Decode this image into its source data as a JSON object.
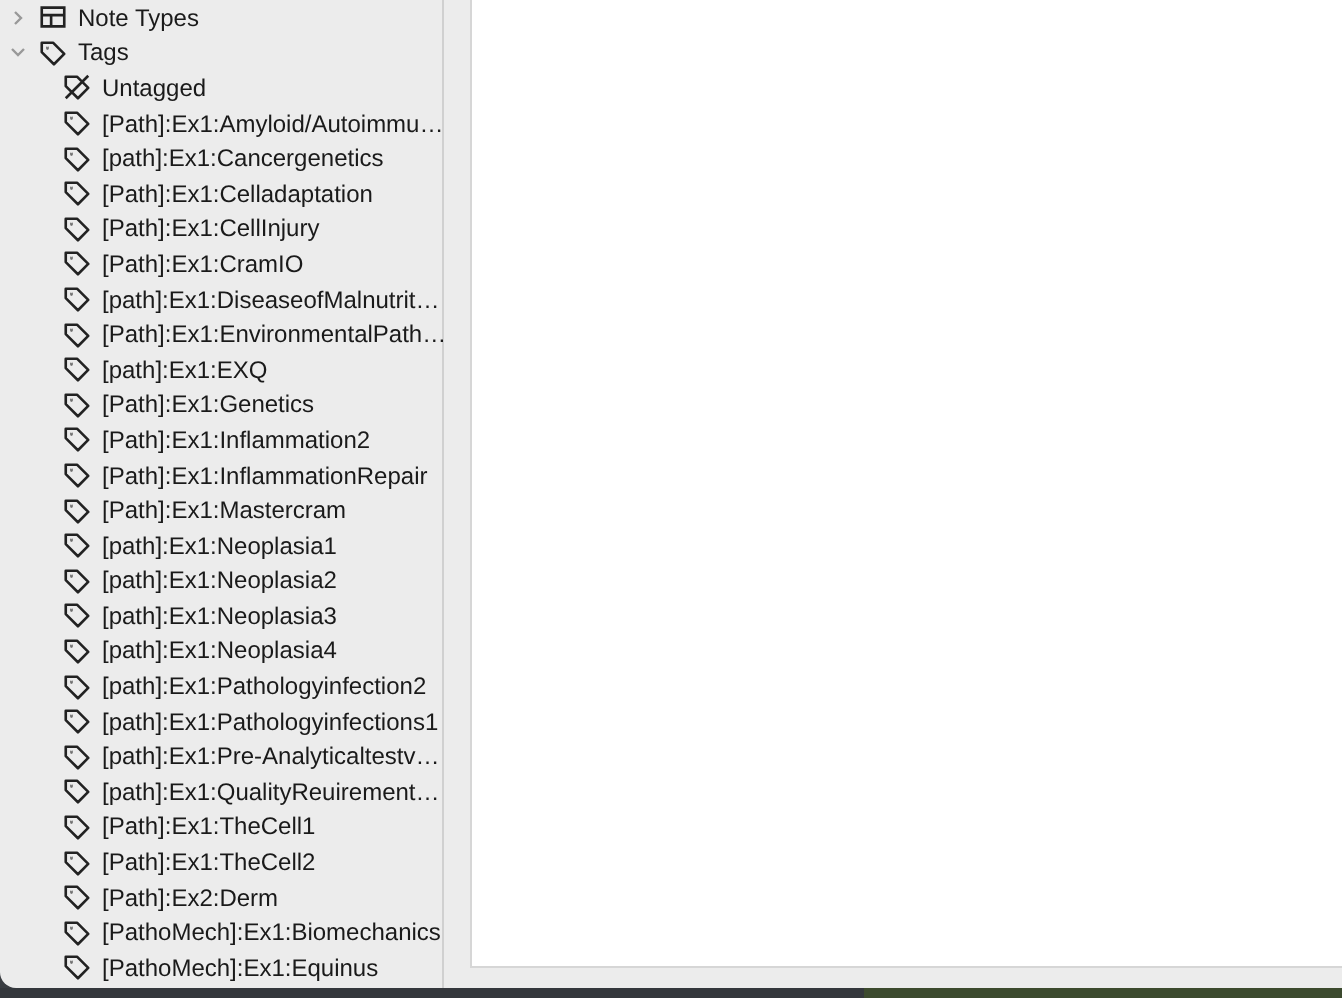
{
  "sidebar": {
    "items": [
      {
        "kind": "notetypes",
        "label": "Note Types",
        "expanded": false
      },
      {
        "kind": "tags",
        "label": "Tags",
        "expanded": true,
        "children": [
          {
            "kind": "untagged",
            "label": "Untagged"
          },
          {
            "kind": "tag",
            "label": "[Path]:Ex1:Amyloid/Autoimmu…"
          },
          {
            "kind": "tag",
            "label": "[path]:Ex1:Cancergenetics"
          },
          {
            "kind": "tag",
            "label": "[Path]:Ex1:Celladaptation"
          },
          {
            "kind": "tag",
            "label": "[Path]:Ex1:CellInjury"
          },
          {
            "kind": "tag",
            "label": "[Path]:Ex1:CramIO"
          },
          {
            "kind": "tag",
            "label": "[path]:Ex1:DiseaseofMalnutrit…"
          },
          {
            "kind": "tag",
            "label": "[Path]:Ex1:EnvironmentalPath…"
          },
          {
            "kind": "tag",
            "label": "[path]:Ex1:EXQ"
          },
          {
            "kind": "tag",
            "label": "[Path]:Ex1:Genetics"
          },
          {
            "kind": "tag",
            "label": "[Path]:Ex1:Inflammation2"
          },
          {
            "kind": "tag",
            "label": "[Path]:Ex1:InflammationRepair"
          },
          {
            "kind": "tag",
            "label": "[Path]:Ex1:Mastercram"
          },
          {
            "kind": "tag",
            "label": "[path]:Ex1:Neoplasia1"
          },
          {
            "kind": "tag",
            "label": "[path]:Ex1:Neoplasia2"
          },
          {
            "kind": "tag",
            "label": "[path]:Ex1:Neoplasia3"
          },
          {
            "kind": "tag",
            "label": "[path]:Ex1:Neoplasia4"
          },
          {
            "kind": "tag",
            "label": "[path]:Ex1:Pathologyinfection2"
          },
          {
            "kind": "tag",
            "label": "[path]:Ex1:Pathologyinfections1"
          },
          {
            "kind": "tag",
            "label": "[path]:Ex1:Pre-Analyticaltestv…"
          },
          {
            "kind": "tag",
            "label": "[path]:Ex1:QualityReuirement…"
          },
          {
            "kind": "tag",
            "label": "[Path]:Ex1:TheCell1"
          },
          {
            "kind": "tag",
            "label": "[Path]:Ex1:TheCell2"
          },
          {
            "kind": "tag",
            "label": "[Path]:Ex2:Derm"
          },
          {
            "kind": "tag",
            "label": "[PathoMech]:Ex1:Biomechanics"
          },
          {
            "kind": "tag",
            "label": "[PathoMech]:Ex1:Equinus"
          }
        ]
      }
    ]
  }
}
